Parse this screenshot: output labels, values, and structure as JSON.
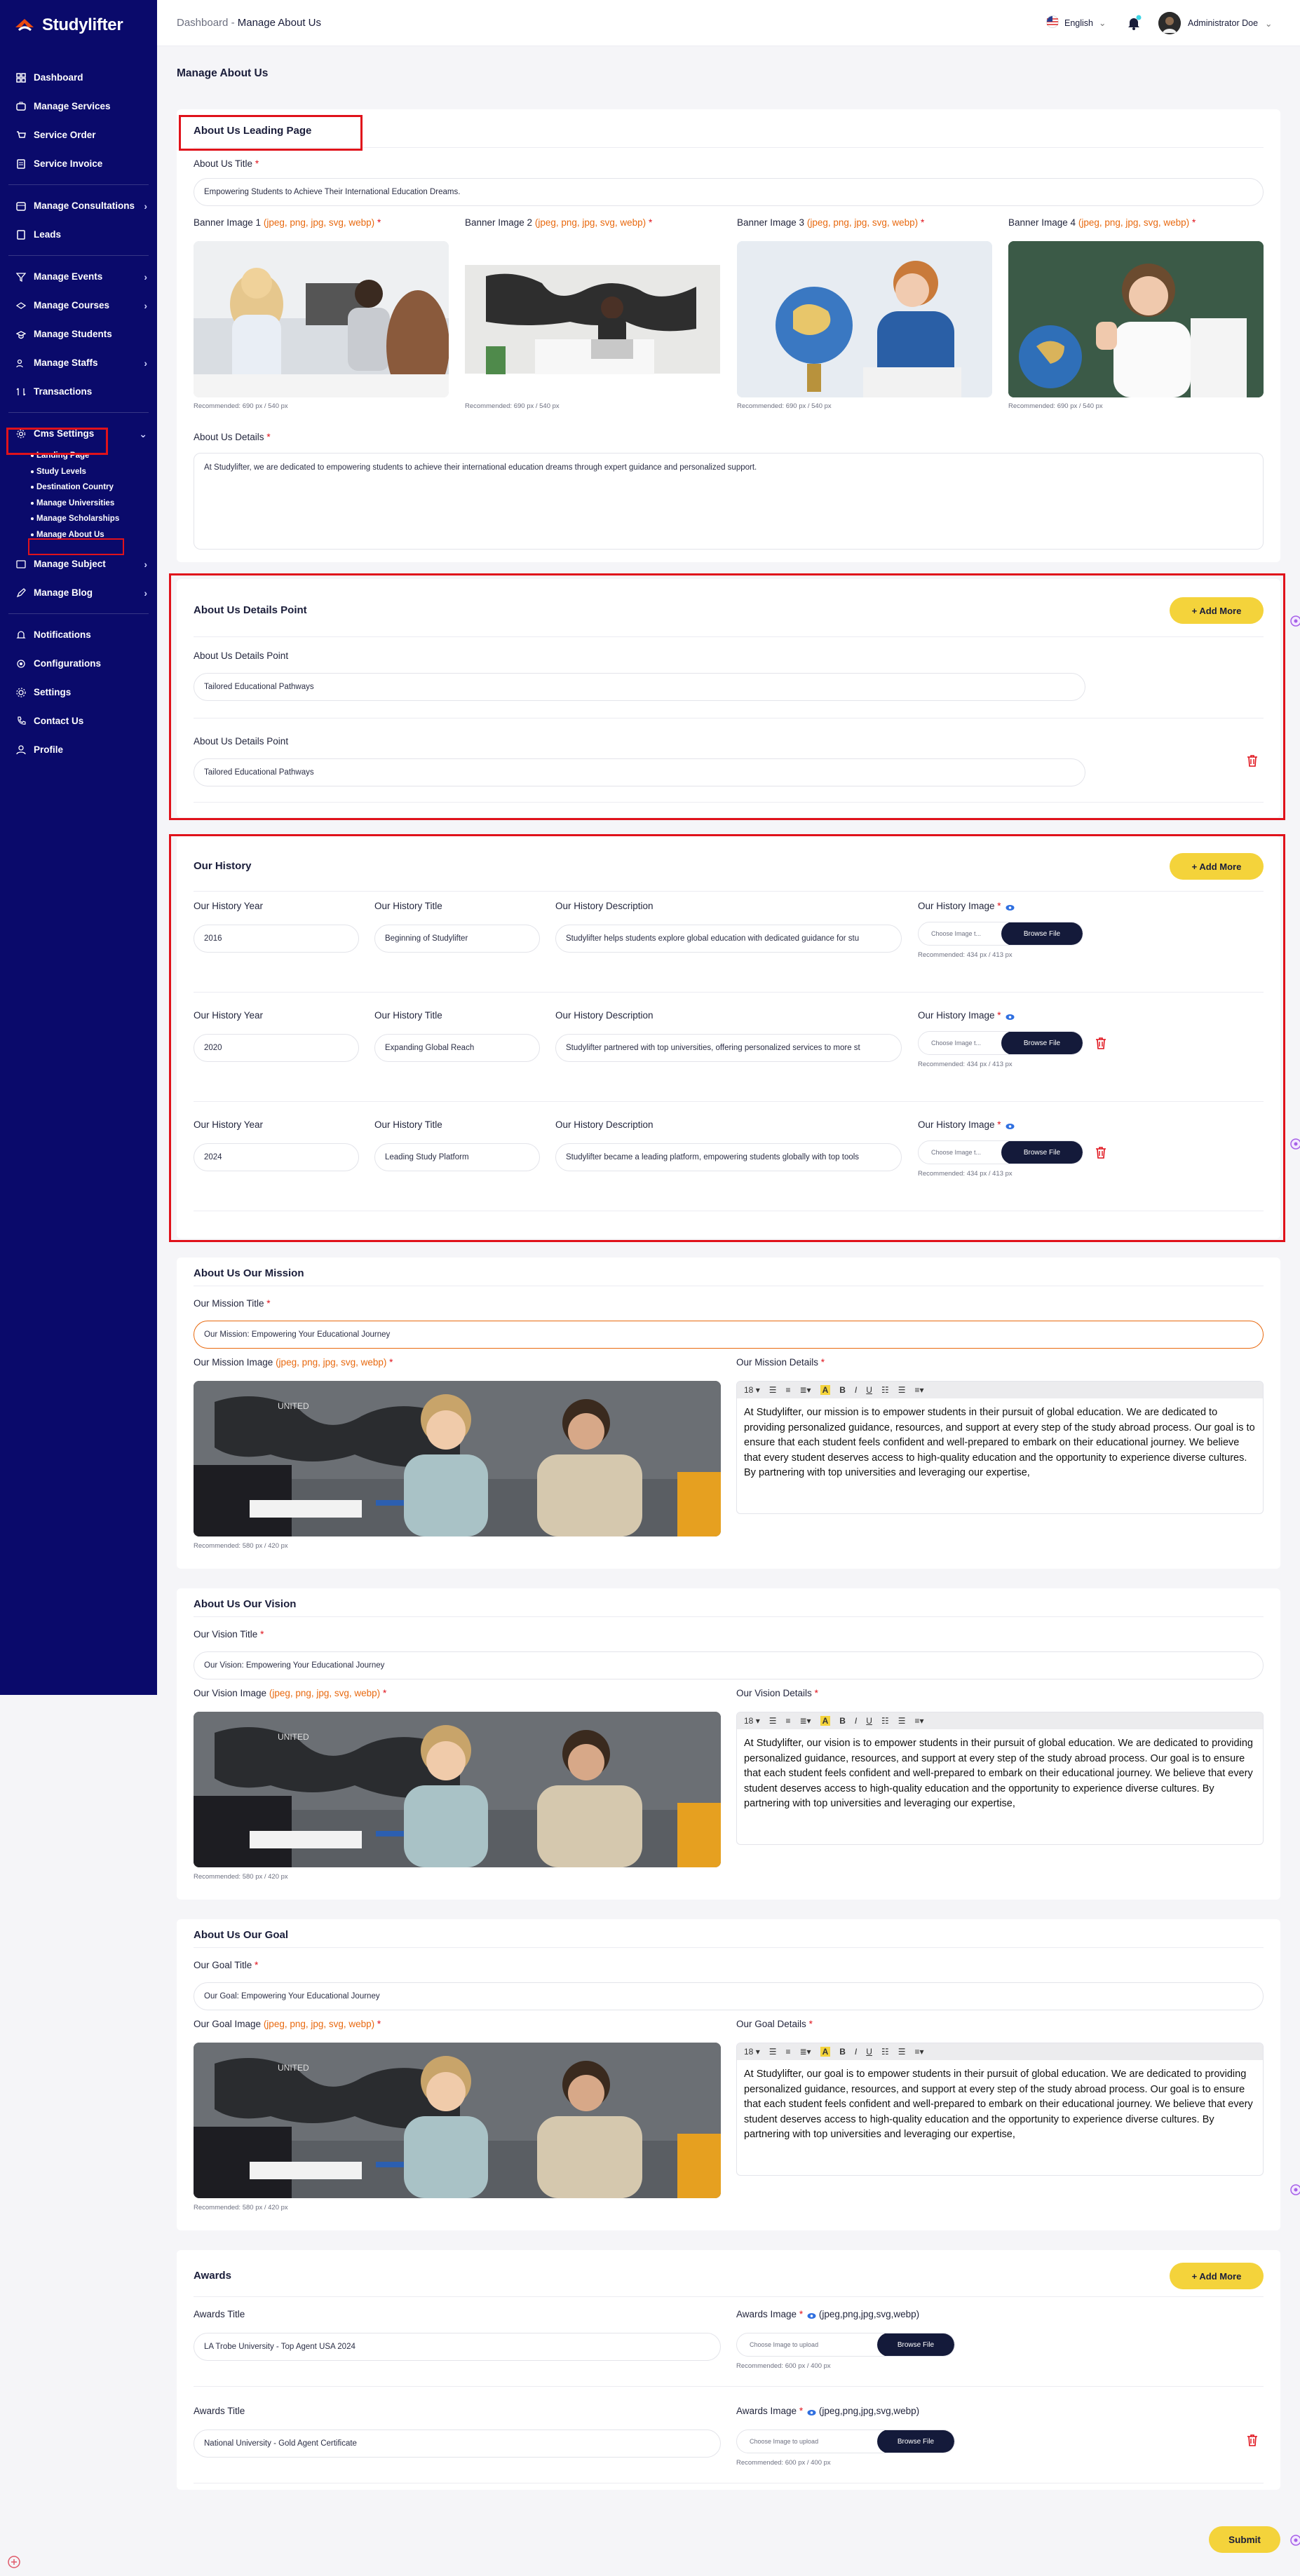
{
  "app": {
    "name": "Studylifter"
  },
  "sidebar": {
    "items": [
      {
        "label": "Dashboard"
      },
      {
        "label": "Manage Services"
      },
      {
        "label": "Service Order"
      },
      {
        "label": "Service Invoice"
      },
      {
        "label": "Manage Consultations"
      },
      {
        "label": "Leads"
      },
      {
        "label": "Manage Events"
      },
      {
        "label": "Manage Courses"
      },
      {
        "label": "Manage Students"
      },
      {
        "label": "Manage Staffs"
      },
      {
        "label": "Transactions"
      },
      {
        "label": "Cms Settings"
      },
      {
        "label": "Manage Subject"
      },
      {
        "label": "Manage Blog"
      },
      {
        "label": "Notifications"
      },
      {
        "label": "Configurations"
      },
      {
        "label": "Settings"
      },
      {
        "label": "Contact Us"
      },
      {
        "label": "Profile"
      }
    ],
    "cms_sub": [
      {
        "label": "Landing Page"
      },
      {
        "label": "Study Levels"
      },
      {
        "label": "Destination Country"
      },
      {
        "label": "Manage Universities"
      },
      {
        "label": "Manage Scholarships"
      },
      {
        "label": "Manage About Us"
      }
    ]
  },
  "header": {
    "breadcrumb_root": "Dashboard",
    "breadcrumb_sep": "-",
    "breadcrumb_current": "Manage About Us",
    "language": "English",
    "user_name": "Administrator Doe"
  },
  "page_title": "Manage About Us",
  "leading": {
    "section_title": "About Us Leading Page",
    "title_label": "About Us Title",
    "title_value": "Empowering Students to Achieve Their International Education Dreams.",
    "banner_labels": [
      "Banner Image 1",
      "Banner Image 2",
      "Banner Image 3",
      "Banner Image 4"
    ],
    "banner_ext": "(jpeg, png, jpg, svg, webp)",
    "banner_hint": "Recommended: 690 px / 540 px",
    "details_label": "About Us Details",
    "details_value": "At Studylifter, we are dedicated to empowering students to achieve their international education dreams through expert guidance and personalized support."
  },
  "details_points": {
    "section_title": "About Us Details Point",
    "add_more": "+ Add More",
    "point_label": "About Us Details Point",
    "points": [
      "Tailored Educational Pathways",
      "Tailored Educational Pathways"
    ]
  },
  "history": {
    "section_title": "Our History",
    "add_more": "+ Add More",
    "year_label": "Our History Year",
    "title_label": "Our History Title",
    "desc_label": "Our History Description",
    "image_label": "Our History Image",
    "choose_placeholder": "Choose Image t...",
    "browse": "Browse File",
    "hint": "Recommended: 434 px / 413 px",
    "rows": [
      {
        "year": "2016",
        "title": "Beginning of Studylifter",
        "desc": "Studylifter helps students explore global education with dedicated guidance for stu"
      },
      {
        "year": "2020",
        "title": "Expanding Global Reach",
        "desc": "Studylifter partnered with top universities, offering personalized services to more st"
      },
      {
        "year": "2024",
        "title": "Leading Study Platform",
        "desc": "Studylifter became a leading platform, empowering students globally with top tools"
      }
    ]
  },
  "mission": {
    "section_title": "About Us Our Mission",
    "title_label": "Our Mission Title",
    "title_value": "Our Mission: Empowering Your  Educational Journey",
    "image_label": "Our Mission Image",
    "image_ext": "(jpeg, png, jpg, svg, webp)",
    "hint": "Recommended: 580 px / 420 px",
    "details_label": "Our Mission Details",
    "details_value": "At Studylifter, our mission is to empower students in their pursuit of global education. We are dedicated to providing personalized guidance, resources, and support at every step of the study abroad process. Our goal is to ensure that each student feels confident and well-prepared to embark on their educational journey. We believe that every student deserves access to high-quality education and the opportunity to experience diverse cultures. By partnering with top universities and leveraging our expertise,"
  },
  "vision": {
    "section_title": "About Us Our Vision",
    "title_label": "Our Vision Title",
    "title_value": "Our Vision: Empowering Your  Educational Journey",
    "image_label": "Our Vision Image",
    "image_ext": "(jpeg, png, jpg, svg, webp)",
    "hint": "Recommended: 580 px / 420 px",
    "details_label": "Our Vision Details",
    "details_value": "At Studylifter, our vision is to empower students in their pursuit of global education. We are dedicated to providing personalized guidance, resources, and support at every step of the study abroad process. Our goal is to ensure that each student feels confident and well-prepared to embark on their educational journey. We believe that every student deserves access to high-quality education and the opportunity to experience diverse cultures. By partnering with top universities and leveraging our expertise,"
  },
  "goal": {
    "section_title": "About Us Our Goal",
    "title_label": "Our Goal Title",
    "title_value": "Our Goal: Empowering Your  Educational Journey",
    "image_label": "Our Goal Image",
    "image_ext": "(jpeg, png, jpg, svg, webp)",
    "hint": "Recommended: 580 px / 420 px",
    "details_label": "Our Goal Details",
    "details_value": "At Studylifter, our goal is to empower students in their pursuit of global education. We are dedicated to providing personalized guidance, resources, and support at every step of the study abroad process. Our goal is to ensure that each student feels confident and well-prepared to embark on their educational journey. We believe that every student deserves access to high-quality education and the opportunity to experience diverse cultures. By partnering with top universities and leveraging our expertise,"
  },
  "editor_toolbar": {
    "size": "18"
  },
  "awards": {
    "section_title": "Awards",
    "add_more": "+ Add More",
    "title_label": "Awards Title",
    "image_label": "Awards Image",
    "image_ext": "(jpeg,png,jpg,svg,webp)",
    "choose_placeholder": "Choose Image to upload",
    "browse": "Browse File",
    "hint": "Recommended: 600 px / 400 px",
    "rows": [
      {
        "title": "LA Trobe University -  Top Agent USA 2024"
      },
      {
        "title": "National University -  Gold Agent Certificate"
      }
    ]
  },
  "submit": "Submit",
  "colors": {
    "sidebar": "#0a0a6b",
    "accent": "#f4d33b",
    "highlight": "#e0121b",
    "required": "#e0121b",
    "extension": "#e8690f",
    "button_dark": "#141a3a"
  }
}
